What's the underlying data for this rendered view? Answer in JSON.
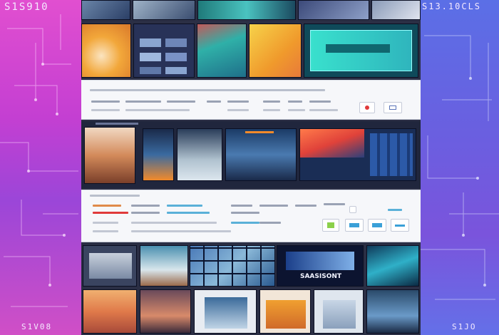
{
  "side_left": {
    "label_top": "S1S910",
    "label_bottom": "S1V08"
  },
  "side_right": {
    "label_top": "S13.10CLS",
    "label_bottom": "S1JO"
  },
  "banner_text": "SAASISONT",
  "colors": {
    "accent_pink": "#e14fd0",
    "accent_blue": "#5b6fe6",
    "teal": "#2fd0c2",
    "orange": "#f2a73a",
    "red_dot": "#e03a3a"
  },
  "icons": [
    "circuit-pattern-icon",
    "record-icon",
    "window-icon",
    "arrow-icon"
  ]
}
